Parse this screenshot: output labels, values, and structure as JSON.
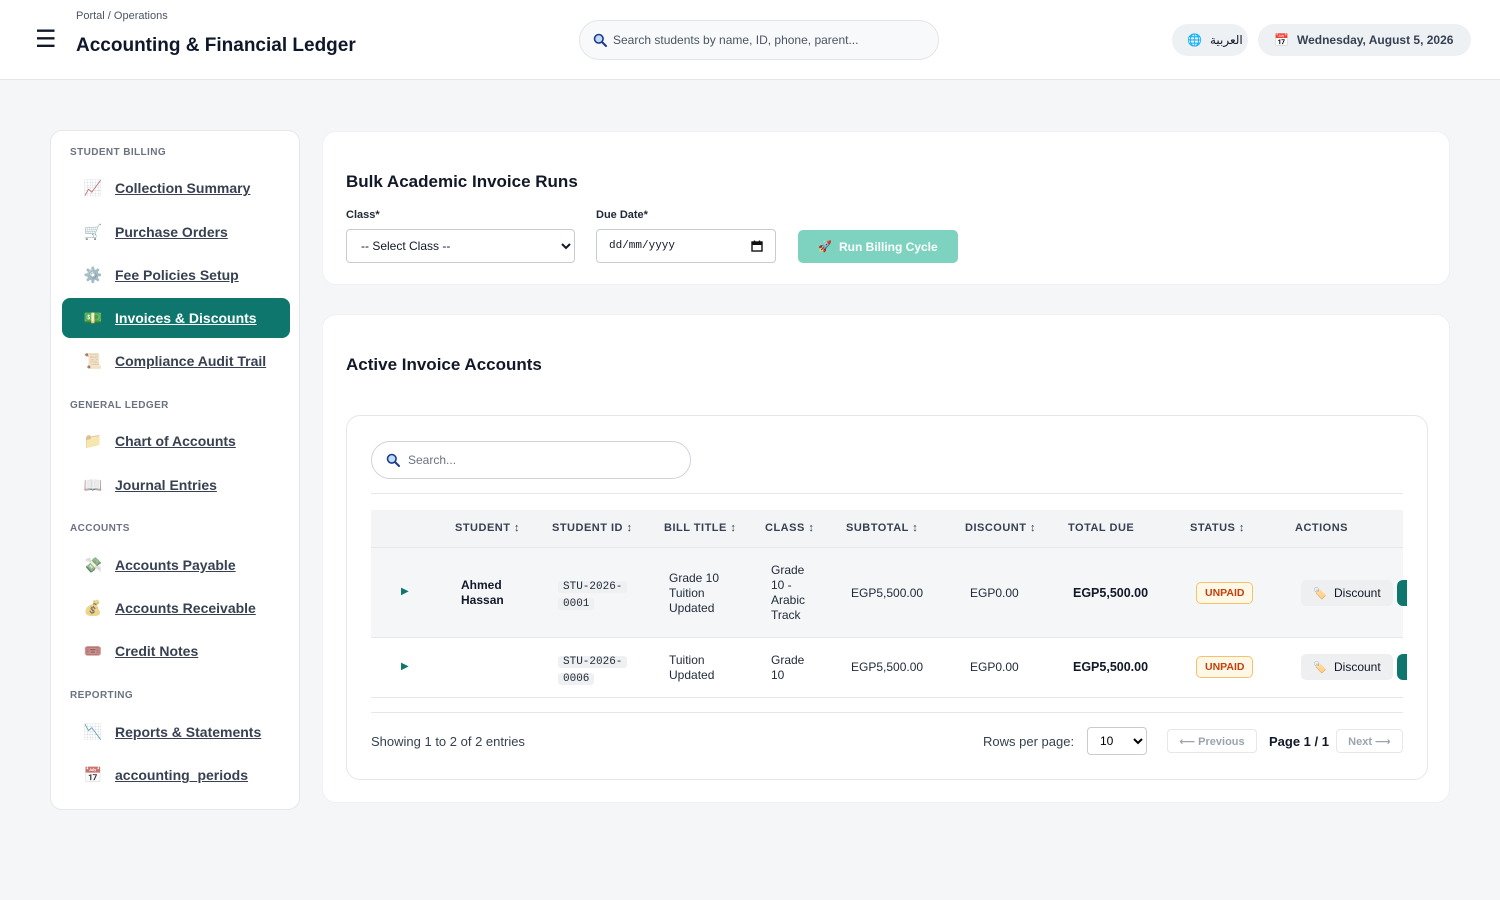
{
  "header": {
    "breadcrumb": "Portal / Operations",
    "title": "Accounting & Financial Ledger",
    "search_placeholder": "Search students by name, ID, phone, parent...",
    "language_label": "العربية",
    "date_label": "Wednesday, August 5, 2026"
  },
  "sidebar": {
    "sections": [
      {
        "title": "STUDENT BILLING"
      },
      {
        "title": "GENERAL LEDGER"
      },
      {
        "title": "ACCOUNTS"
      },
      {
        "title": "REPORTING"
      }
    ],
    "items": [
      {
        "label": "Collection Summary",
        "icon": "chart-up-icon"
      },
      {
        "label": "Purchase Orders",
        "icon": "cart-icon"
      },
      {
        "label": "Fee Policies Setup",
        "icon": "gear-icon"
      },
      {
        "label": "Invoices & Discounts",
        "icon": "money-icon",
        "active": true
      },
      {
        "label": "Compliance Audit Trail",
        "icon": "scroll-icon"
      },
      {
        "label": "Chart of Accounts",
        "icon": "folder-icon"
      },
      {
        "label": "Journal Entries",
        "icon": "book-icon"
      },
      {
        "label": "Accounts Payable",
        "icon": "money-wings-icon"
      },
      {
        "label": "Accounts Receivable",
        "icon": "money-bag-icon"
      },
      {
        "label": "Credit Notes",
        "icon": "ticket-icon"
      },
      {
        "label": "Reports & Statements",
        "icon": "chart-down-icon"
      },
      {
        "label": "accounting_periods",
        "icon": "calendar-icon"
      }
    ]
  },
  "bulk": {
    "title": "Bulk Academic Invoice Runs",
    "class_label": "Class*",
    "class_selected": "-- Select Class --",
    "due_label": "Due Date*",
    "due_placeholder": "dd/mm/yyyy",
    "run_button": "Run Billing Cycle"
  },
  "invoices": {
    "title": "Active Invoice Accounts",
    "search_placeholder": "Search...",
    "columns": [
      "STUDENT ↕",
      "STUDENT ID ↕",
      "BILL TITLE ↕",
      "CLASS ↕",
      "SUBTOTAL ↕",
      "DISCOUNT ↕",
      "TOTAL DUE",
      "STATUS ↕",
      "ACTIONS"
    ],
    "rows": [
      {
        "student_line1": "Ahmed",
        "student_line2": "Hassan",
        "id_line1": "STU-2026-",
        "id_line2": "0001",
        "bill_lines": [
          "Grade 10",
          "Tuition",
          "Updated"
        ],
        "class_lines": [
          "Grade",
          "10 -",
          "Arabic",
          "Track"
        ],
        "subtotal": "EGP5,500.00",
        "discount": "EGP0.00",
        "total": "EGP5,500.00",
        "status": "UNPAID",
        "action": "Discount"
      },
      {
        "student_line1": "",
        "student_line2": "",
        "id_line1": "STU-2026-",
        "id_line2": "0006",
        "bill_lines": [
          "Tuition",
          "Updated"
        ],
        "class_lines": [
          "Grade",
          "10"
        ],
        "subtotal": "EGP5,500.00",
        "discount": "EGP0.00",
        "total": "EGP5,500.00",
        "status": "UNPAID",
        "action": "Discount"
      }
    ],
    "showing": "Showing 1 to 2 of 2 entries",
    "rows_per_page_label": "Rows per page:",
    "rows_per_page": "10",
    "prev_label": "⟵ Previous",
    "page_label": "Page 1 / 1",
    "next_label": "Next ⟶"
  },
  "colors": {
    "accent": "#0f766e",
    "accent_light": "#7dd3c0",
    "unpaid_text": "#c2410c",
    "unpaid_border": "#f5c26b"
  }
}
